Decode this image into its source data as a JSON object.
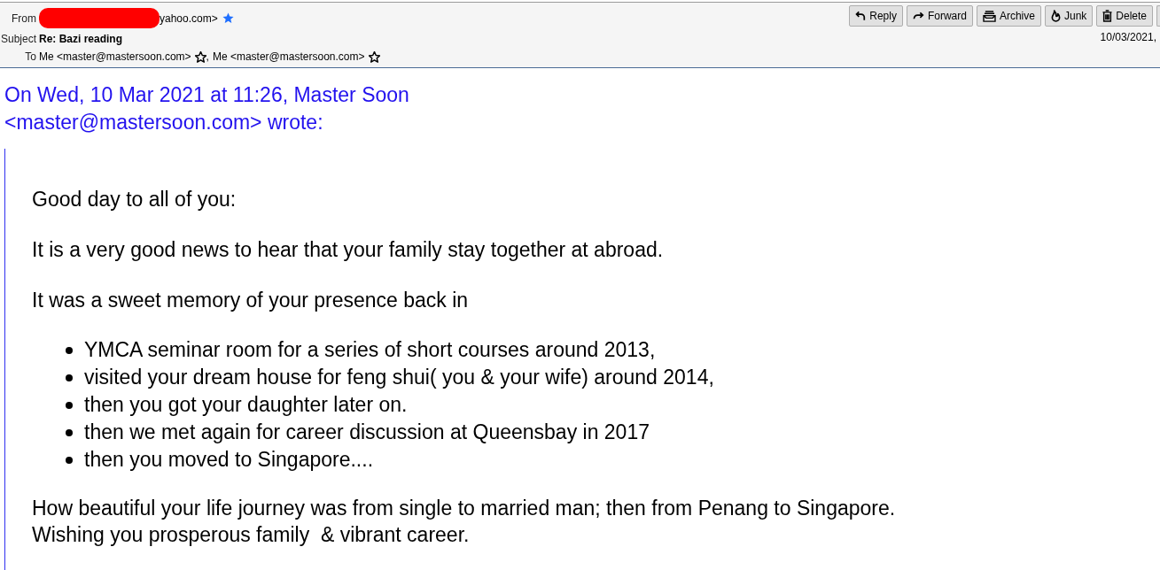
{
  "message_header": {
    "from": {
      "label": "From",
      "redacted": true,
      "address": "yahoo.com>",
      "starred": true
    },
    "subject": {
      "label": "Subject",
      "value": "Re: Bazi reading"
    },
    "to": {
      "label": "To",
      "separator": ",",
      "recipients": [
        {
          "name": "Me <master@mastersoon.com>",
          "starred": false
        },
        {
          "name": "Me <master@mastersoon.com>",
          "starred": false
        }
      ]
    },
    "toolbar": [
      {
        "kind": "reply",
        "label": "Reply"
      },
      {
        "kind": "forward",
        "label": "Forward"
      },
      {
        "kind": "archive",
        "label": "Archive"
      },
      {
        "kind": "junk",
        "label": "Junk"
      },
      {
        "kind": "delete",
        "label": "Delete"
      }
    ],
    "date": "10/03/2021,"
  },
  "body": {
    "quote_header": "On Wed, 10 Mar 2021 at 11:26, Master Soon <master@mastersoon.com> wrote:",
    "paragraphs": [
      "Good day to all of you:",
      "It is a very good news to hear that your family stay together at abroad.",
      "It was a sweet memory of your presence back in"
    ],
    "list_items": [
      "YMCA seminar room for a series of short courses around 2013,",
      "visited your dream house for feng shui( you & your wife) around 2014,",
      "then you got your daughter later on.",
      "then we met again for career discussion at Queensbay in 2017",
      "then you moved to Singapore...."
    ],
    "closing_lines": [
      "How beautiful your life journey was from single to married man; then from Penang to Singapore.",
      "Wishing you prosperous family  & vibrant career."
    ]
  }
}
